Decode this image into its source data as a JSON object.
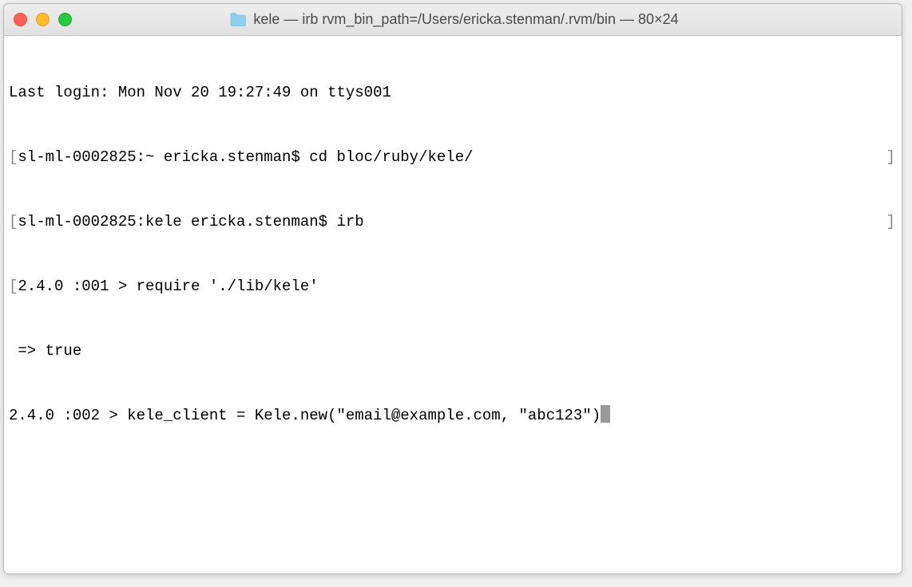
{
  "window": {
    "title": "kele — irb rvm_bin_path=/Users/ericka.stenman/.rvm/bin — 80×24",
    "folder_icon": "folder-icon"
  },
  "terminal": {
    "lines": [
      {
        "text": "Last login: Mon Nov 20 19:27:49 on ttys001",
        "bracket_left": "",
        "bracket_right": ""
      },
      {
        "text": "sl-ml-0002825:~ ericka.stenman$ cd bloc/ruby/kele/",
        "bracket_left": "[",
        "bracket_right": "]"
      },
      {
        "text": "sl-ml-0002825:kele ericka.stenman$ irb",
        "bracket_left": "[",
        "bracket_right": "]"
      },
      {
        "text": "2.4.0 :001 > require './lib/kele'",
        "bracket_left": "[",
        "bracket_right": ""
      },
      {
        "text": " => true ",
        "bracket_left": "",
        "bracket_right": ""
      },
      {
        "text": "2.4.0 :002 > kele_client = Kele.new(\"email@example.com, \"abc123\")",
        "bracket_left": "",
        "bracket_right": "",
        "cursor": true
      }
    ]
  }
}
